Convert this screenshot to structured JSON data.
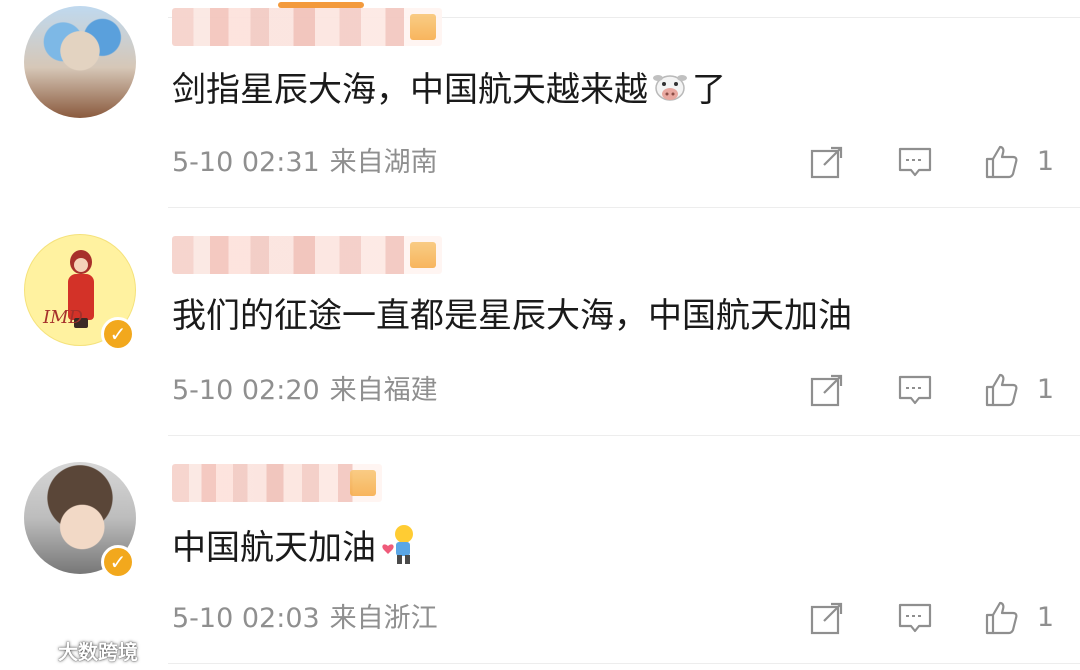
{
  "colors": {
    "accent": "#f39a3c",
    "verified_badge": "#f2a81d",
    "meta_text": "#8f8f8f",
    "body_text": "#1a1a1a"
  },
  "comments": [
    {
      "text": "剑指星辰大海，中国航天越来越",
      "text_suffix": "了",
      "inline_emoji": "cow-face",
      "date": "5-10 02:31",
      "source": "来自湖南",
      "likes": "1",
      "verified": false
    },
    {
      "text": "我们的征途一直都是星辰大海，中国航天加油",
      "text_suffix": "",
      "inline_emoji": "",
      "date": "5-10 02:20",
      "source": "来自福建",
      "likes": "1",
      "verified": true,
      "avatar_mark": "IMD"
    },
    {
      "text": "中国航天加油",
      "text_suffix": "",
      "inline_emoji": "person-holding-heart",
      "date": "5-10 02:03",
      "source": "来自浙江",
      "likes": "1",
      "verified": true
    }
  ],
  "icons": {
    "share": "share-icon",
    "comment": "comment-icon",
    "like": "thumbs-up-icon",
    "verified": "verified-icon"
  },
  "watermark": {
    "text": "大数跨境"
  }
}
